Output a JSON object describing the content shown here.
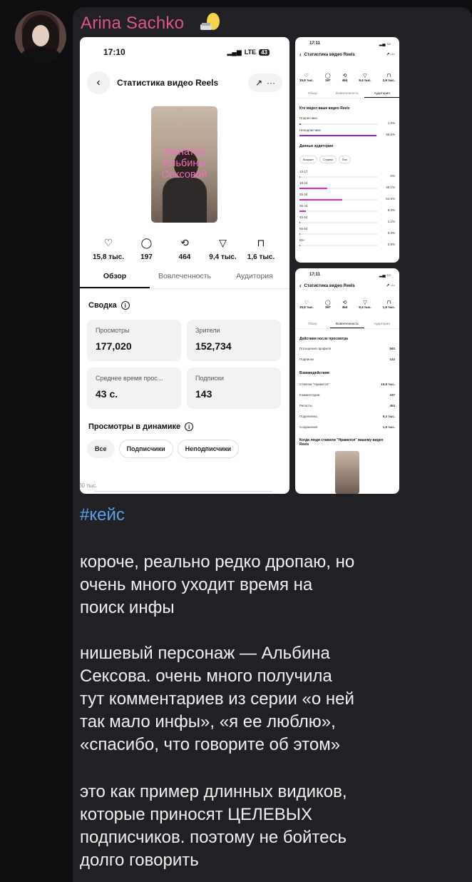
{
  "author": "Arina Sachko",
  "main_shot": {
    "time": "17:10",
    "lte": "LTE",
    "battery": "43",
    "title": "Статистика видео Reels",
    "overlay_text": "фанатка Альбины Сексовой",
    "stats": [
      {
        "icon": "heart-icon",
        "glyph": "♡",
        "value": "15,8 тыс."
      },
      {
        "icon": "comment-icon",
        "glyph": "◯",
        "value": "197"
      },
      {
        "icon": "repost-icon",
        "glyph": "⟲",
        "value": "464"
      },
      {
        "icon": "share-icon",
        "glyph": "▽",
        "value": "9,4 тыс."
      },
      {
        "icon": "bookmark-icon",
        "glyph": "⊓",
        "value": "1,6 тыс."
      }
    ],
    "tabs": [
      "Обзор",
      "Вовлеченность",
      "Аудитория"
    ],
    "active_tab": "Обзор",
    "summary_title": "Сводка",
    "cards": [
      {
        "label": "Просмотры",
        "value": "177,020"
      },
      {
        "label": "Зрители",
        "value": "152,734"
      },
      {
        "label": "Среднее время прос...",
        "value": "43 с."
      },
      {
        "label": "Подписки",
        "value": "143"
      }
    ],
    "dynamics_title": "Просмотры в динамике",
    "chips": [
      "Все",
      "Подписчики",
      "Неподписчики"
    ],
    "axis_label": "00 тыс."
  },
  "shot_r1": {
    "time": "17:11",
    "title": "Статистика видео Reels",
    "stats": [
      "15,8 тыс.",
      "197",
      "464",
      "9,4 тыс.",
      "1,6 тыс."
    ],
    "tabs": [
      "Обзор",
      "Вовлеченность",
      "Аудитория"
    ],
    "who_title": "Кто видел ваше видео Reels",
    "followers_label": "Подписчики",
    "followers_pct": "1,5%",
    "followers_value": 1.5,
    "nonfollowers_label": "Неподписчики",
    "nonfollowers_pct": "98,5%",
    "nonfollowers_value": 98.5,
    "audience_title": "Данные аудитории",
    "chips": [
      "Возраст",
      "Страна",
      "Пол"
    ],
    "ages": [
      {
        "label": "13-17",
        "pct": "0%",
        "value": 0
      },
      {
        "label": "18-24",
        "pct": "35,1%",
        "value": 35.1
      },
      {
        "label": "25-34",
        "pct": "54,5%",
        "value": 54.5
      },
      {
        "label": "35-44",
        "pct": "8,3%",
        "value": 8.3
      },
      {
        "label": "45-54",
        "pct": "1,1%",
        "value": 1.1
      },
      {
        "label": "55-64",
        "pct": "0,3%",
        "value": 0.3
      },
      {
        "label": "65+",
        "pct": "0,8%",
        "value": 0.8
      }
    ]
  },
  "shot_r2": {
    "time": "17:11",
    "title": "Статистика видео Reels",
    "stats": [
      "15,8 тыс.",
      "197",
      "464",
      "9,4 тыс.",
      "1,6 тыс."
    ],
    "tabs": [
      "Обзор",
      "Вовлеченность",
      "Аудитория"
    ],
    "actions_title": "Действия после просмотра",
    "actions": [
      {
        "label": "Посещения профиля",
        "value": "563"
      },
      {
        "label": "Подписки",
        "value": "143"
      }
    ],
    "interactions_title": "Взаимодействия",
    "interactions": [
      {
        "label": "Отметки \"Нравится\"",
        "value": "15,8 тыс."
      },
      {
        "label": "Комментарии",
        "value": "197"
      },
      {
        "label": "Репосты",
        "value": "464"
      },
      {
        "label": "Поделились",
        "value": "9,4 тыс."
      },
      {
        "label": "Сохранения",
        "value": "1,6 тыс."
      }
    ],
    "likes_when_title": "Когда люди ставили \"Нравится\" вашему видео Reels"
  },
  "hashtag": "#кейс",
  "paragraphs": [
    "короче, реально редко дропаю, но\nочень много уходит время на\nпоиск инфы",
    "нишевый персонаж — Альбина\nСексова. очень много получила\nтут комментариев из серии «о ней\nтак мало инфы», «я ее люблю»,\n«спасибо, что говорите об этом»",
    "это как пример длинных видиков,\nкоторые приносят ЦЕЛЕВЫХ\nподписчиков. поэтому не бойтесь\nдолго говорить"
  ]
}
